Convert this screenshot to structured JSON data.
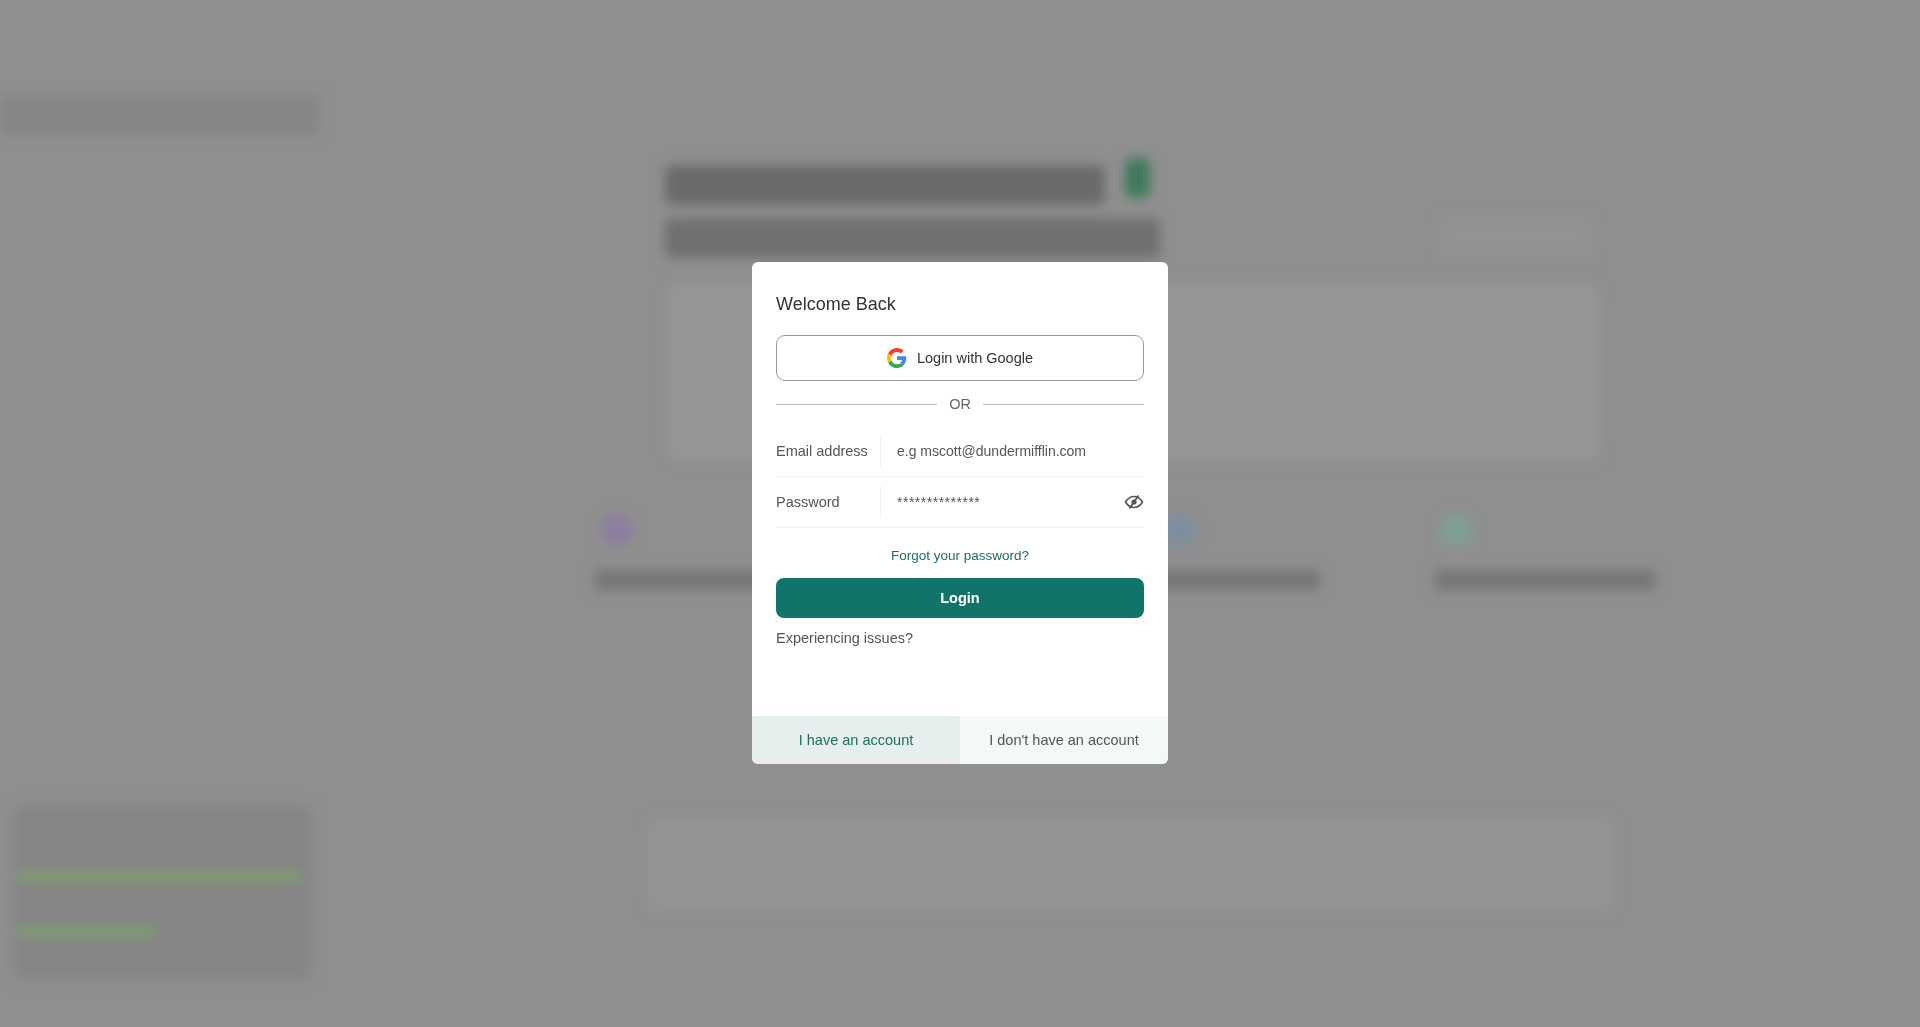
{
  "dialog": {
    "title": "Welcome Back",
    "google_button": "Login with Google",
    "divider": "OR",
    "fields": [
      {
        "label": "Email address",
        "placeholder": "e.g mscott@dundermifflin.com",
        "kind": "text"
      },
      {
        "label": "Password",
        "value": "**************",
        "kind": "password"
      }
    ],
    "forgot_link": "Forgot your password?",
    "login_button": "Login",
    "issues_link": "Experiencing issues?",
    "tabs": [
      {
        "label": "I have an account",
        "selected": true
      },
      {
        "label": "I don't have an account",
        "selected": false
      }
    ]
  }
}
